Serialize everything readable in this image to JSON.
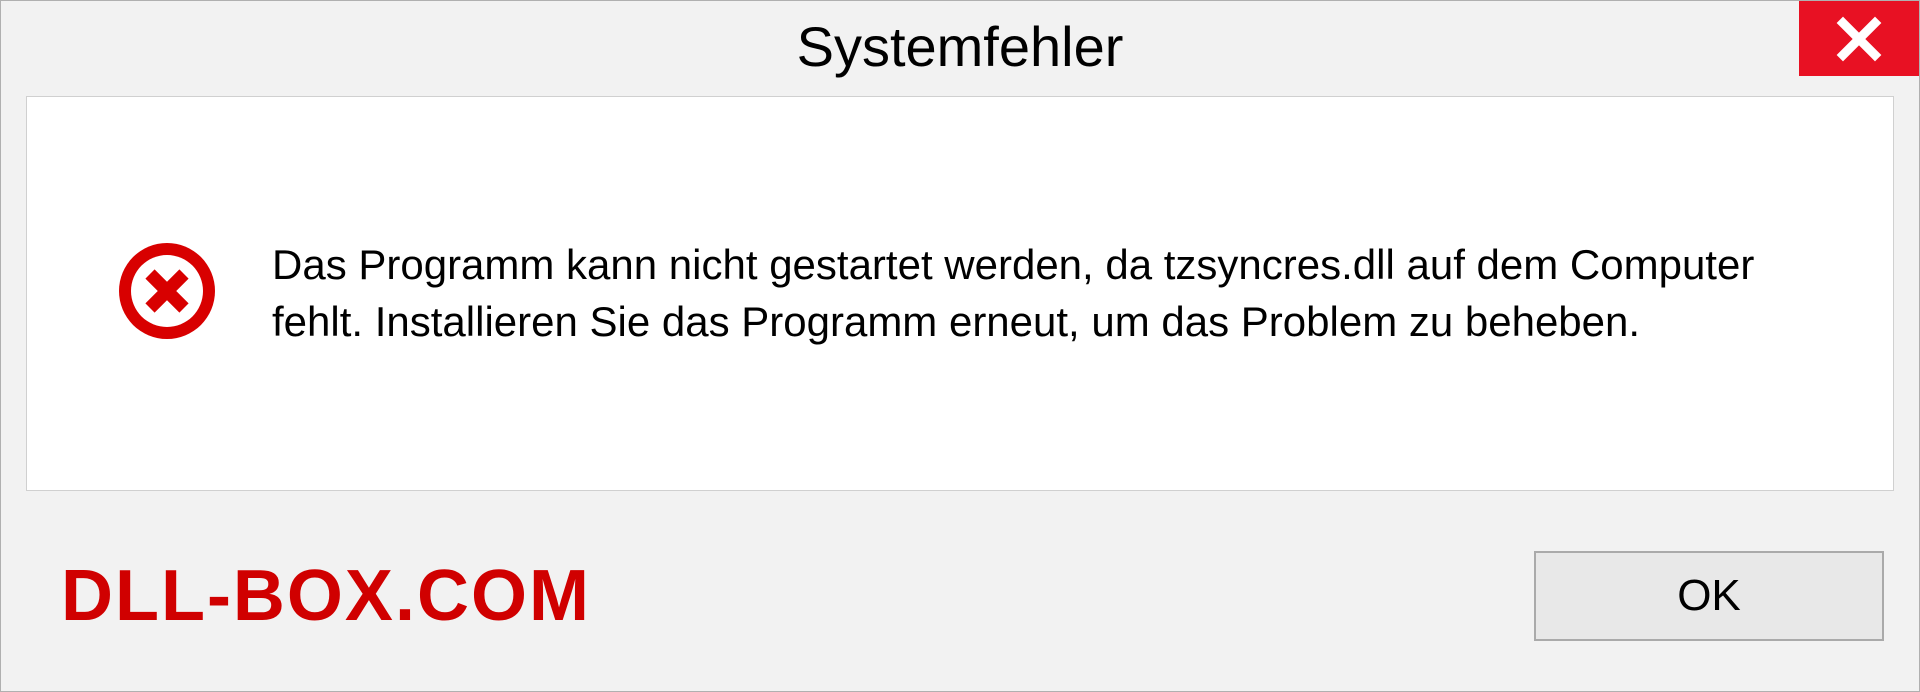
{
  "dialog": {
    "title": "Systemfehler",
    "message": "Das Programm kann nicht gestartet werden, da tzsyncres.dll auf dem Computer fehlt. Installieren Sie das Programm erneut, um das Problem zu beheben.",
    "ok_label": "OK"
  },
  "watermark": {
    "text": "DLL-BOX.COM"
  },
  "colors": {
    "close_button_bg": "#e81123",
    "error_icon": "#d80000",
    "watermark": "#d00000"
  }
}
